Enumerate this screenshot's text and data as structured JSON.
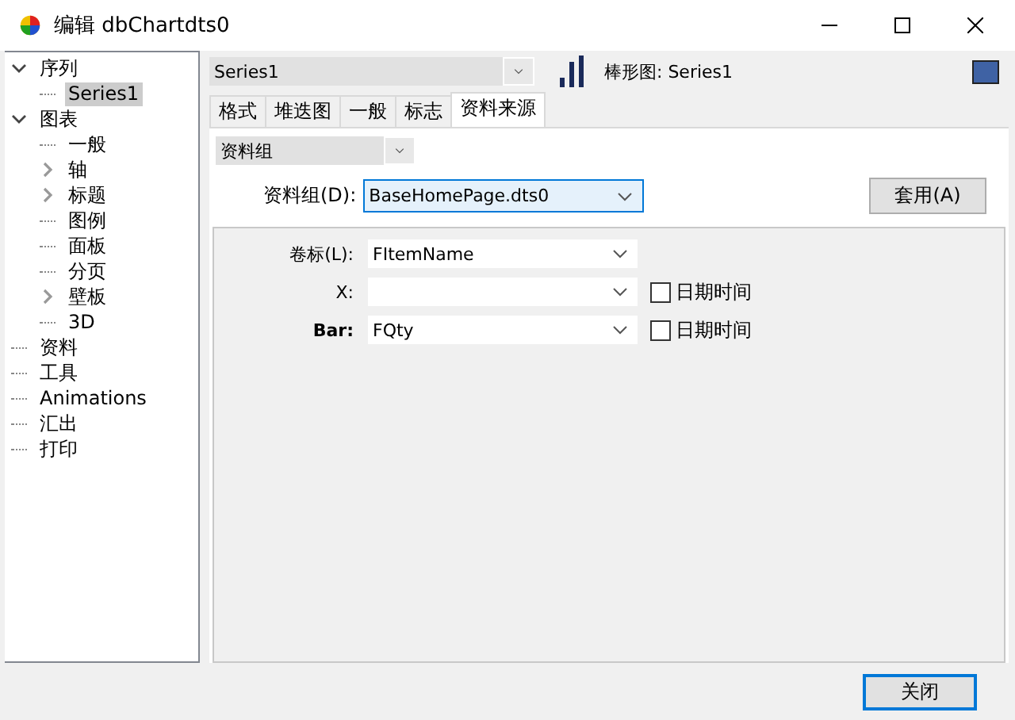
{
  "window": {
    "title": "编辑 dbChartdts0"
  },
  "tree": [
    {
      "label": "序列",
      "expanded": true,
      "selected": false,
      "children": [
        {
          "label": "Series1",
          "selected": true
        }
      ]
    },
    {
      "label": "图表",
      "expanded": true,
      "selected": false,
      "children": [
        {
          "label": "一般",
          "selected": false
        },
        {
          "label": "轴",
          "selected": false,
          "expanded": false
        },
        {
          "label": "标题",
          "selected": false,
          "expanded": false
        },
        {
          "label": "图例",
          "selected": false
        },
        {
          "label": "面板",
          "selected": false
        },
        {
          "label": "分页",
          "selected": false
        },
        {
          "label": "壁板",
          "selected": false,
          "expanded": false
        },
        {
          "label": "3D",
          "selected": false
        }
      ]
    },
    {
      "label": "资料",
      "selected": false
    },
    {
      "label": "工具",
      "selected": false
    },
    {
      "label": "Animations",
      "selected": false
    },
    {
      "label": "汇出",
      "selected": false
    },
    {
      "label": "打印",
      "selected": false
    }
  ],
  "series_select": {
    "value": "Series1"
  },
  "series_info": {
    "label": "棒形图: Series1",
    "color": "#3f62a4"
  },
  "tabs": [
    {
      "label": "格式",
      "selected": false
    },
    {
      "label": "堆迭图",
      "selected": false
    },
    {
      "label": "一般",
      "selected": false
    },
    {
      "label": "标志",
      "selected": false
    },
    {
      "label": "资料来源",
      "selected": true
    }
  ],
  "source_select": {
    "value": "资料组"
  },
  "dataset": {
    "label": "资料组(D):",
    "value": "BaseHomePage.dts0"
  },
  "apply_button": "套用(A)",
  "fields": [
    {
      "label": "卷标(L):",
      "bold": false,
      "value": "FItemName"
    },
    {
      "label": "X:",
      "bold": false,
      "datetime": {
        "label": "日期时间",
        "checked": false
      }
    },
    {
      "label": "Bar:",
      "bold": true,
      "value": "FQty",
      "datetime": {
        "label": "日期时间",
        "checked": false
      }
    }
  ],
  "close_button": "关闭"
}
